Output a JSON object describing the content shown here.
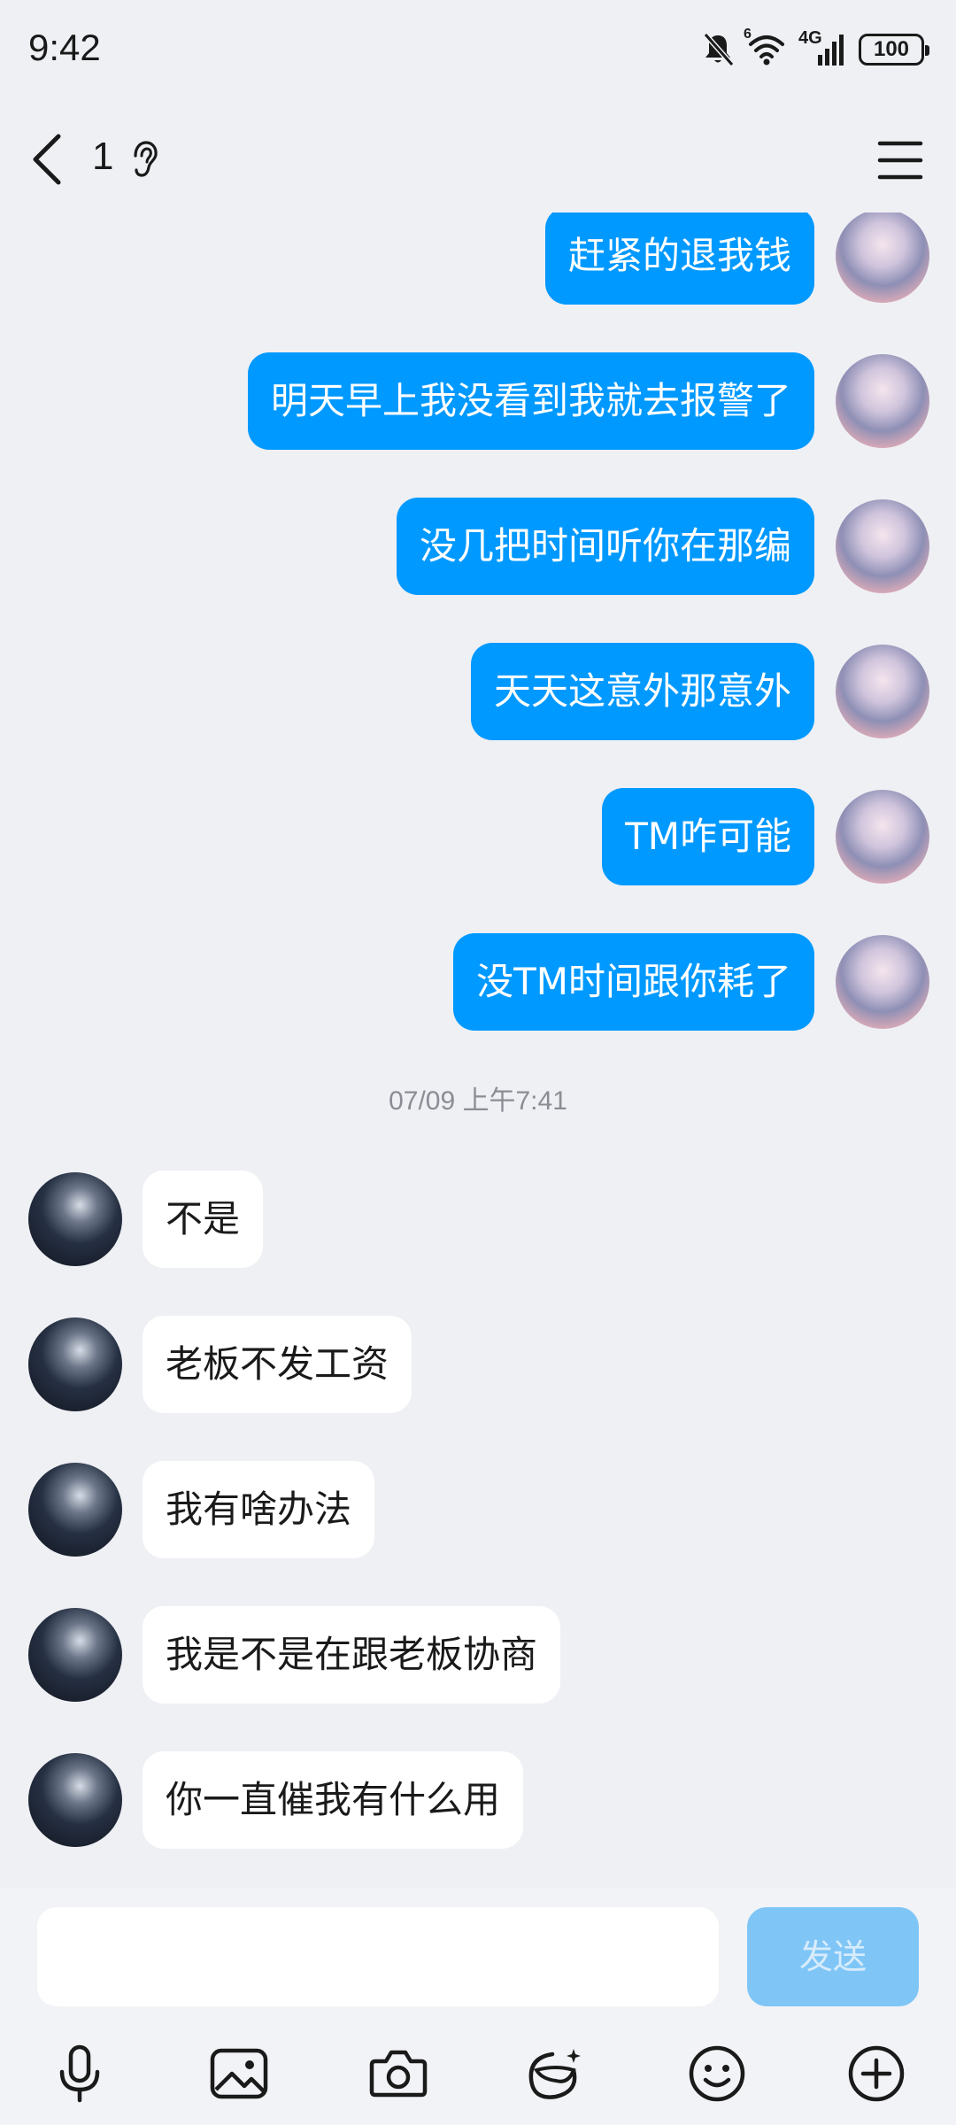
{
  "status_bar": {
    "time": "9:42",
    "network_label": "4G",
    "wifi_label": "6",
    "battery_level": "100"
  },
  "header": {
    "title": "1",
    "back_icon": "chevron-left-icon",
    "ear_icon": "ear-icon",
    "menu_icon": "menu-icon"
  },
  "messages": [
    {
      "side": "outgoing",
      "text": "赶紧的退我钱"
    },
    {
      "side": "outgoing",
      "text": "明天早上我没看到我就去报警了"
    },
    {
      "side": "outgoing",
      "text": "没几把时间听你在那编"
    },
    {
      "side": "outgoing",
      "text": "天天这意外那意外"
    },
    {
      "side": "outgoing",
      "text": "TM咋可能"
    },
    {
      "side": "outgoing",
      "text": "没TM时间跟你耗了"
    },
    {
      "side": "timestamp",
      "text": "07/09 上午7:41"
    },
    {
      "side": "incoming",
      "text": "不是"
    },
    {
      "side": "incoming",
      "text": "老板不发工资"
    },
    {
      "side": "incoming",
      "text": "我有啥办法"
    },
    {
      "side": "incoming",
      "text": "我是不是在跟老板协商"
    },
    {
      "side": "incoming",
      "text": "你一直催我有什么用"
    }
  ],
  "input": {
    "value": "",
    "placeholder": "",
    "send_label": "发送"
  },
  "toolbar": {
    "items": [
      "microphone-icon",
      "image-icon",
      "camera-icon",
      "sticker-icon",
      "emoji-icon",
      "plus-icon"
    ]
  },
  "colors": {
    "outgoing_bubble": "#0099ff",
    "incoming_bubble": "#ffffff",
    "background": "#eff0f4",
    "send_button_disabled": "#7fc6f7"
  }
}
